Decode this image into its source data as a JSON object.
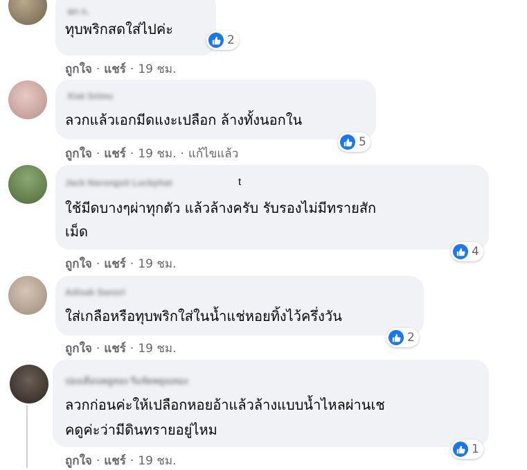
{
  "comments": [
    {
      "author": "ผก ก.",
      "text_lines": [
        "ทุบพริกสดใส่ไปค่ะ"
      ],
      "like_label": "ถูกใจ",
      "share_label": "แชร์",
      "time": "19 ชม.",
      "edited": "",
      "reaction_icon": "like-icon",
      "reactions": "2"
    },
    {
      "author": "Kiat Srimu",
      "text_lines": [
        "ลวกแล้วเอกมีดแงะเปลือก ล้างทั้งนอกใน"
      ],
      "like_label": "ถูกใจ",
      "share_label": "แชร์",
      "time": "19 ชม.",
      "edited": "แก้ไขแล้ว",
      "reaction_icon": "like-icon",
      "reactions": "5"
    },
    {
      "author": "Jack Narongsit Luckphat",
      "author_suffix": "t",
      "text_lines": [
        "ใช้มีดบางๆผ่าทุกตัว แล้วล้างครับ รับรองไม่มีทรายสัก",
        "เม็ด"
      ],
      "like_label": "ถูกใจ",
      "share_label": "แชร์",
      "time": "19 ชม.",
      "edited": "",
      "reaction_icon": "like-icon",
      "reactions": "4"
    },
    {
      "author": "Adisak Sanori",
      "text_lines": [
        "ใส่เกลือหรือทุบพริกใส่ในน้ำแช่หอยทิ้งไว้ครึ่งวัน"
      ],
      "like_label": "ถูกใจ",
      "share_label": "แชร์",
      "time": "19 ชม.",
      "edited": "",
      "reaction_icon": "like-icon",
      "reactions": "2"
    },
    {
      "author": "ปองเดือนพลูทอง ริมจัดพยุณทอง",
      "text_lines": [
        "ลวกก่อนค่ะให้เปลือกหอยอ้าแล้วล้างแบบน้ำไหลผ่านเช",
        "คดูค่ะว่ามีดินทรายอยู่ไหม"
      ],
      "like_label": "ถูกใจ",
      "share_label": "แชร์",
      "time": "19 ชม.",
      "edited": "",
      "reaction_icon": "like-icon",
      "reactions": "1"
    }
  ],
  "colors": {
    "like_blue": "#1877f2",
    "bubble": "#f0f2f5",
    "meta_text": "#65676b"
  }
}
